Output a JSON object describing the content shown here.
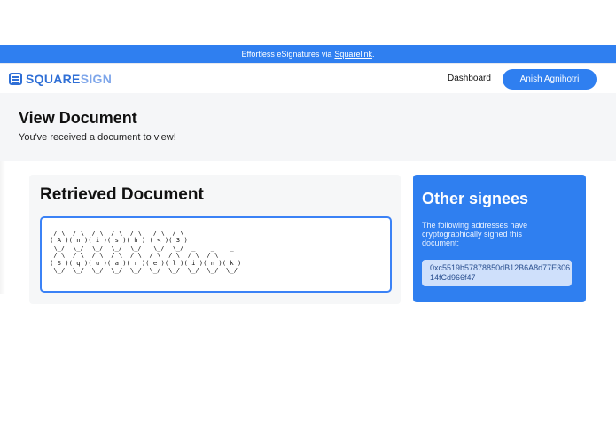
{
  "banner": {
    "text": "Effortless eSignatures via",
    "link": "Squarelink",
    "suffix": "."
  },
  "nav": {
    "logo_primary": "SQUARE",
    "logo_secondary": "SIGN",
    "dashboard": "Dashboard",
    "user": "Anish Agnihotri"
  },
  "header": {
    "title": "View Document",
    "subtitle": "You've received a document to view!"
  },
  "document": {
    "title": "Retrieved Document",
    "content": " / \\  / \\  / \\  / \\  / \\   / \\  / \\\n( A )( n )( i )( s )( h ) ( < )( 3 )\n \\_/  \\_/  \\_/  \\_/  \\_/   \\_/  \\_/  _    _    _\n / \\  / \\  / \\  / \\  / \\  / \\  / \\  / \\  / \\\n( S )( q )( u )( a )( r )( e )( l )( i )( n )( k )\n \\_/  \\_/  \\_/  \\_/  \\_/  \\_/  \\_/  \\_/  \\_/  \\_/"
  },
  "signees": {
    "title": "Other signees",
    "description": "The following addresses have cryptographically signed this document:",
    "addresses": [
      "0xc5519b57878850dB12B6A8d77E30614fCd966f47"
    ]
  },
  "colors": {
    "primary": "#2f7ff0",
    "address_bg": "#cfe0fb"
  }
}
